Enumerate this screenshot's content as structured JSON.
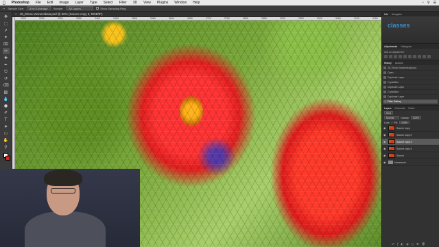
{
  "menubar": {
    "app": "Photoshop",
    "items": [
      "File",
      "Edit",
      "Image",
      "Layer",
      "Type",
      "Select",
      "Filter",
      "3D",
      "View",
      "Plugins",
      "Window",
      "Help"
    ]
  },
  "options": {
    "sample_size_label": "Sample Size:",
    "sample_size_value": "5 by 5 Average",
    "sample_label": "Sample:",
    "sample_value": "All Layers",
    "show_ring_label": "Show Sampling Ring"
  },
  "document": {
    "tab_title": "48_Elena Vosnevskaia.psd @ 50% (Source copy 3, RGB/8*)"
  },
  "ruler_ticks": [
    "2200",
    "2250",
    "2300",
    "2350",
    "2400",
    "2450",
    "2500",
    "2550",
    "2600",
    "2650",
    "2700",
    "2750",
    "2800",
    "2850",
    "2900",
    "2950",
    "3000",
    "3050",
    "3100",
    "3150"
  ],
  "tools": [
    "move-icon",
    "marquee-icon",
    "lasso-icon",
    "quick-select-icon",
    "crop-icon",
    "eyedropper-icon",
    "healing-icon",
    "brush-icon",
    "stamp-icon",
    "history-brush-icon",
    "eraser-icon",
    "gradient-icon",
    "blur-icon",
    "dodge-icon",
    "pen-icon",
    "type-icon",
    "path-select-icon",
    "rectangle-icon",
    "hand-icon",
    "zoom-icon"
  ],
  "colors": {
    "foreground": "#ffffff",
    "background": "#d22222",
    "accent": "#3aa0e8"
  },
  "panels": {
    "top_tabs": [
      "Info",
      "Navigator"
    ],
    "watermark": "classes",
    "adjustments": {
      "tabs": [
        "Adjustments",
        "Histogram"
      ],
      "hint": "Add an adjustment"
    },
    "history": {
      "tabs": [
        "History",
        "Actions"
      ],
      "snapshot": "48_Elena Vosnevskaia.psd",
      "items": [
        "Open",
        "Duplicate Layer",
        "Crystallize",
        "Duplicate Layer",
        "Crystallize",
        "Duplicate Layer",
        "Filter Gallery"
      ]
    },
    "layers": {
      "tabs": [
        "Layers",
        "Channels",
        "Paths"
      ],
      "kind": "Kind",
      "blend_mode": "Normal",
      "opacity_label": "Opacity:",
      "opacity": "100%",
      "lock_label": "Lock:",
      "fill_label": "Fill:",
      "fill": "100%",
      "items": [
        "Source copy",
        "Source copy 2",
        "Source copy 3",
        "Source copy 4",
        "Source",
        "Homework"
      ]
    }
  }
}
